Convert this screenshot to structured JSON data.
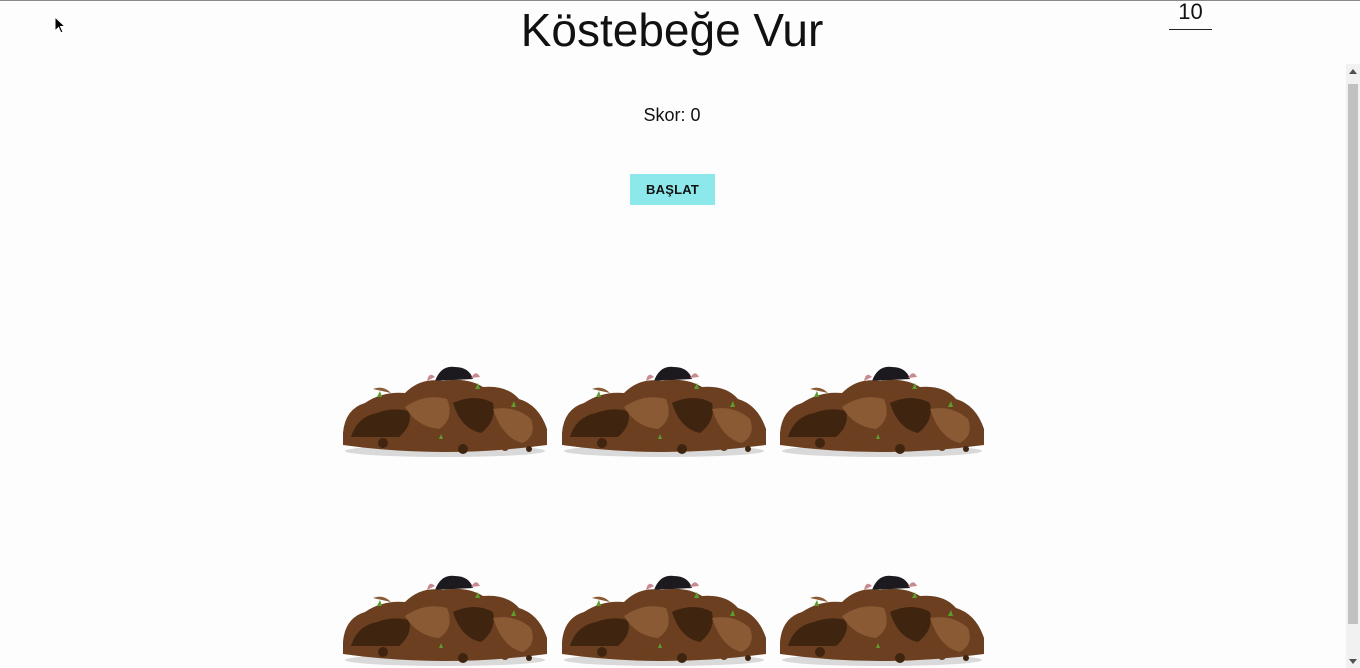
{
  "game": {
    "title": "Köstebeğe Vur",
    "timer": "10",
    "score_text": "Skor: 0",
    "start_label": "BAŞLAT"
  },
  "colors": {
    "start_button": "#8ce8ea",
    "dirt_dark": "#3f2410",
    "dirt_mid": "#6b3f1f",
    "dirt_light": "#8a5a34",
    "mole": "#1c1a1e",
    "grass": "#5e9c2e",
    "shadow": "#d9d9d9"
  },
  "holes": [
    {
      "id": 1,
      "icon": "dirt-mound-icon"
    },
    {
      "id": 2,
      "icon": "dirt-mound-icon"
    },
    {
      "id": 3,
      "icon": "dirt-mound-icon"
    },
    {
      "id": 4,
      "icon": "dirt-mound-icon"
    },
    {
      "id": 5,
      "icon": "dirt-mound-icon"
    },
    {
      "id": 6,
      "icon": "dirt-mound-icon"
    }
  ]
}
